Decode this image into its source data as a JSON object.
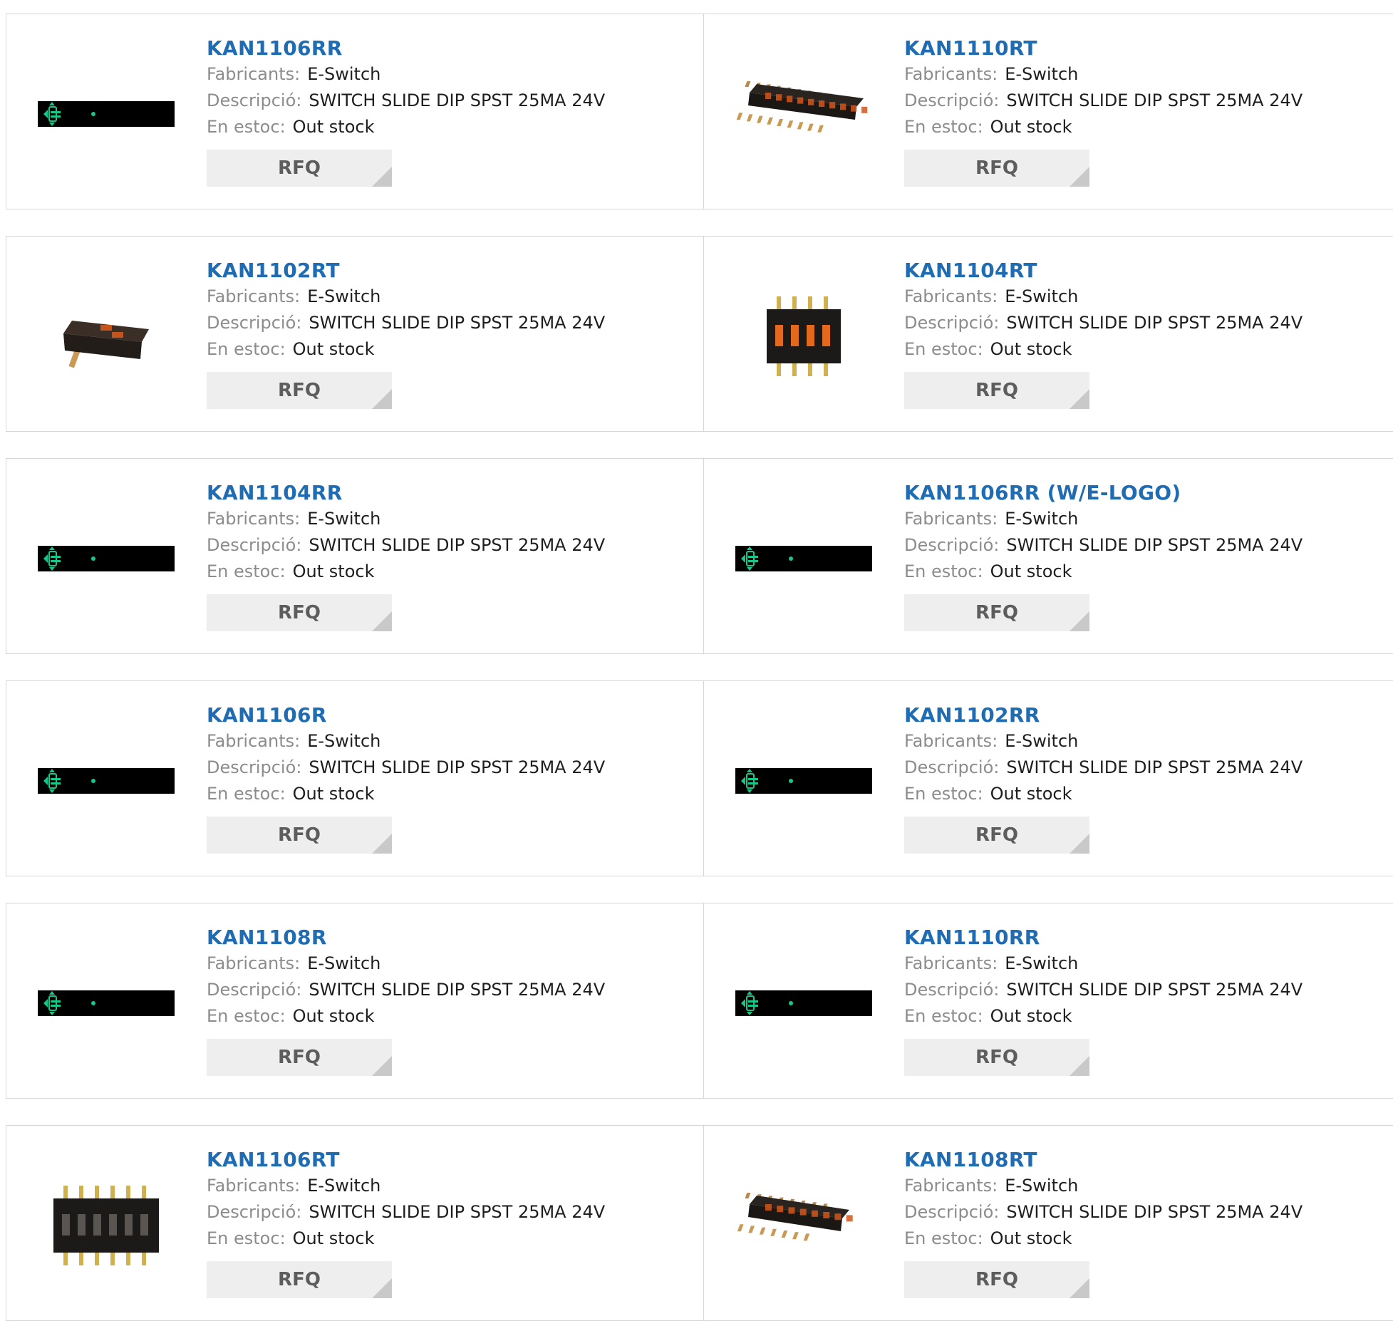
{
  "labels": {
    "manufacturer": "Fabricants:",
    "description": "Descripció:",
    "stock": "En estoc:",
    "rfq": "RFQ"
  },
  "products": [
    {
      "part": "KAN1106RR",
      "manufacturer": "E-Switch",
      "description": "SWITCH SLIDE DIP SPST 25MA 24V",
      "stock": "Out stock",
      "image": "placeholder-icon"
    },
    {
      "part": "KAN1110RT",
      "manufacturer": "E-Switch",
      "description": "SWITCH SLIDE DIP SPST 25MA 24V",
      "stock": "Out stock",
      "image": "dip-switch-10-angled"
    },
    {
      "part": "KAN1102RT",
      "manufacturer": "E-Switch",
      "description": "SWITCH SLIDE DIP SPST 25MA 24V",
      "stock": "Out stock",
      "image": "dip-switch-2-angled"
    },
    {
      "part": "KAN1104RT",
      "manufacturer": "E-Switch",
      "description": "SWITCH SLIDE DIP SPST 25MA 24V",
      "stock": "Out stock",
      "image": "dip-switch-4-top"
    },
    {
      "part": "KAN1104RR",
      "manufacturer": "E-Switch",
      "description": "SWITCH SLIDE DIP SPST 25MA 24V",
      "stock": "Out stock",
      "image": "placeholder-icon"
    },
    {
      "part": "KAN1106RR (W/E-LOGO)",
      "manufacturer": "E-Switch",
      "description": "SWITCH SLIDE DIP SPST 25MA 24V",
      "stock": "Out stock",
      "image": "placeholder-icon"
    },
    {
      "part": "KAN1106R",
      "manufacturer": "E-Switch",
      "description": "SWITCH SLIDE DIP SPST 25MA 24V",
      "stock": "Out stock",
      "image": "placeholder-icon"
    },
    {
      "part": "KAN1102RR",
      "manufacturer": "E-Switch",
      "description": "SWITCH SLIDE DIP SPST 25MA 24V",
      "stock": "Out stock",
      "image": "placeholder-icon"
    },
    {
      "part": "KAN1108R",
      "manufacturer": "E-Switch",
      "description": "SWITCH SLIDE DIP SPST 25MA 24V",
      "stock": "Out stock",
      "image": "placeholder-icon"
    },
    {
      "part": "KAN1110RR",
      "manufacturer": "E-Switch",
      "description": "SWITCH SLIDE DIP SPST 25MA 24V",
      "stock": "Out stock",
      "image": "placeholder-icon"
    },
    {
      "part": "KAN1106RT",
      "manufacturer": "E-Switch",
      "description": "SWITCH SLIDE DIP SPST 25MA 24V",
      "stock": "Out stock",
      "image": "dip-switch-6-top"
    },
    {
      "part": "KAN1108RT",
      "manufacturer": "E-Switch",
      "description": "SWITCH SLIDE DIP SPST 25MA 24V",
      "stock": "Out stock",
      "image": "dip-switch-8-angled"
    }
  ]
}
